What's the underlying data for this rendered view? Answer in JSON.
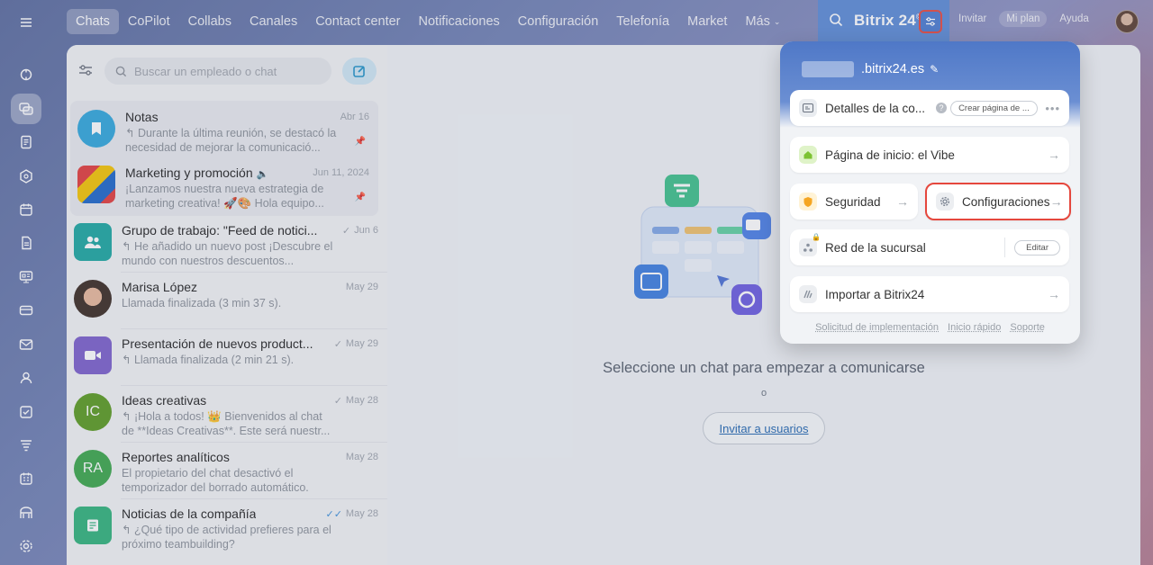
{
  "topnav": {
    "items": [
      "Chats",
      "CoPilot",
      "Collabs",
      "Canales",
      "Contact center",
      "Notificaciones",
      "Configuración",
      "Telefonía",
      "Market",
      "Más"
    ],
    "active": "Chats"
  },
  "brand": {
    "name": "Bitrix 24",
    "mark": "©"
  },
  "top_right": {
    "invite": "Invitar",
    "plan": "Mi plan",
    "help": "Ayuda"
  },
  "search": {
    "placeholder": "Buscar un empleado o chat"
  },
  "chats": [
    {
      "name": "Notas",
      "date": "Abr 16",
      "msg": "↰ Durante la última reunión, se destacó la necesidad de mejorar la comunicació...",
      "pinned": true,
      "color": "#2fa6dc",
      "icon": "bookmark-icon"
    },
    {
      "name": "Marketing y promoción",
      "date": "Jun 11, 2024",
      "msg": "¡Lanzamos nuestra nueva estrategia de marketing creativa! 🚀🎨 Hola equipo...",
      "pinned": true,
      "muted": true,
      "icon": "marketing-avatar"
    },
    {
      "name": "Grupo de trabajo: \"Feed de notici...",
      "date": "Jun 6",
      "msg": "↰ He añadido un nuevo post ¡Descubre el mundo con nuestros descuentos...",
      "color": "#1aa6a0",
      "icon": "group-icon",
      "check": "✓"
    },
    {
      "name": "Marisa López",
      "date": "May 29",
      "msg": "Llamada finalizada (3 min 37 s).",
      "icon": "user-photo"
    },
    {
      "name": "Presentación de nuevos product...",
      "date": "May 29",
      "msg": "↰ Llamada finalizada (2 min 21 s).",
      "color": "#7a5fcb",
      "icon": "video-icon",
      "check": "✓"
    },
    {
      "name": "Ideas creativas",
      "date": "May 28",
      "msg": "↰ ¡Hola a todos! 👑 Bienvenidos al chat de **Ideas Creativas**. Este será nuestr...",
      "color": "#5a9a1f",
      "initials": "IC",
      "check": "✓"
    },
    {
      "name": "Reportes analíticos",
      "date": "May 28",
      "msg": "El propietario del chat desactivó el temporizador del borrado automático.",
      "color": "#3aa64a",
      "initials": "RA"
    },
    {
      "name": "Noticias de la compañía",
      "date": "May 28",
      "msg": "↰ ¿Qué tipo de actividad prefieres para el próximo teambuilding?",
      "color": "#2fb37a",
      "icon": "news-icon",
      "check": "✓✓"
    }
  ],
  "center": {
    "empty_title": "Seleccione un chat para empezar a comunicarse",
    "or": "o",
    "invite_button": "Invitar a usuarios"
  },
  "popup": {
    "portal_domain": ".bitrix24.es",
    "details_label": "Detalles de la co...",
    "details_pill": "Crear página de ...",
    "homepage_label": "Página de inicio: el Vibe",
    "security_label": "Seguridad",
    "settings_label": "Configuraciones",
    "network_label": "Red de la sucursal",
    "network_edit": "Editar",
    "import_label": "Importar a Bitrix24",
    "footer": [
      "Solicitud de implementación",
      "Inicio rápido",
      "Soporte"
    ]
  }
}
